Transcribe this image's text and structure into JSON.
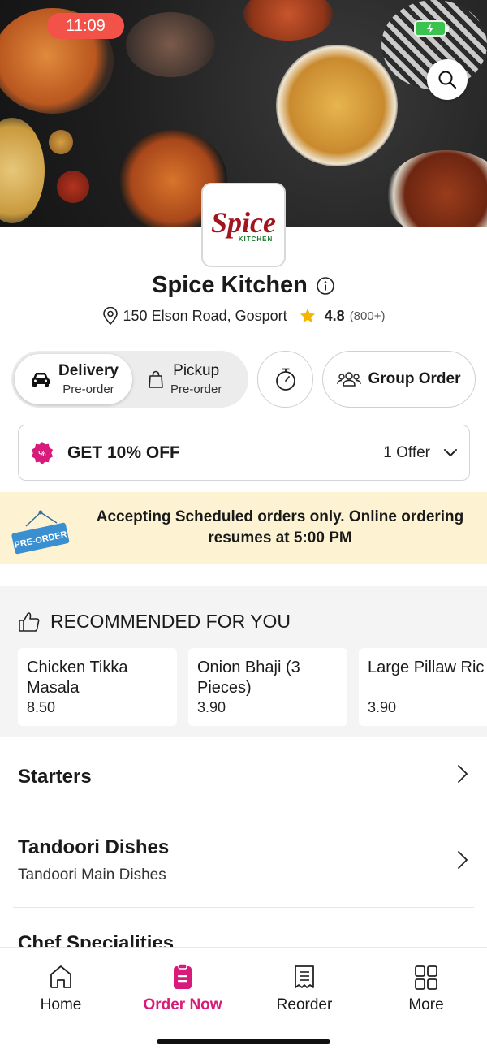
{
  "status_bar": {
    "time": "11:09"
  },
  "restaurant": {
    "name": "Spice Kitchen",
    "logo_text": "Spice",
    "logo_subtext": "KITCHEN",
    "address": "150 Elson Road, Gosport",
    "rating": "4.8",
    "rating_count": "(800+)"
  },
  "order_modes": [
    {
      "label": "Delivery",
      "sub": "Pre-order",
      "selected": true,
      "icon": "car-icon"
    },
    {
      "label": "Pickup",
      "sub": "Pre-order",
      "selected": false,
      "icon": "shopping-bag-icon"
    }
  ],
  "group_order_label": "Group Order",
  "offer": {
    "title": "GET 10% OFF",
    "count": "1 Offer"
  },
  "banner": {
    "tag": "PRE-ORDER",
    "message": "Accepting Scheduled orders only. Online ordering resumes at 5:00 PM"
  },
  "recommended": {
    "heading": "RECOMMENDED FOR YOU",
    "items": [
      {
        "name": "Chicken Tikka Masala",
        "price": "8.50"
      },
      {
        "name": "Onion Bhaji (3 Pieces)",
        "price": "3.90"
      },
      {
        "name": "Large Pillaw Ric",
        "price": "3.90"
      }
    ]
  },
  "categories": [
    {
      "title": "Starters",
      "subtitle": ""
    },
    {
      "title": "Tandoori Dishes",
      "subtitle": "Tandoori Main Dishes"
    },
    {
      "title": "Chef Specialities",
      "subtitle": ""
    }
  ],
  "bottom_nav": [
    {
      "label": "Home",
      "icon": "home-icon",
      "active": false
    },
    {
      "label": "Order Now",
      "icon": "order-icon",
      "active": true
    },
    {
      "label": "Reorder",
      "icon": "receipt-icon",
      "active": false
    },
    {
      "label": "More",
      "icon": "grid-icon",
      "active": false
    }
  ],
  "colors": {
    "accent": "#d81b7a",
    "banner_bg": "#fdf3d3",
    "status_time_bg": "#f25247",
    "star": "#f5b400"
  }
}
